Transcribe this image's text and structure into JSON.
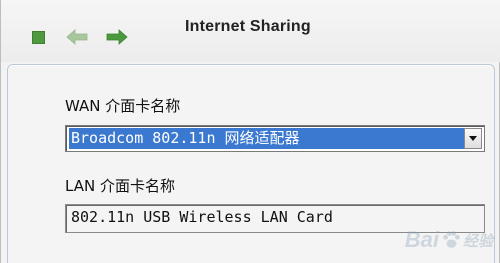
{
  "window": {
    "title": "Internet Sharing"
  },
  "toolbar": {
    "stop_icon": "stop-icon",
    "back_icon": "back-arrow-icon",
    "forward_icon": "forward-arrow-icon",
    "accent_color": "#4f9a3e"
  },
  "wan": {
    "label": "WAN 介面卡名称",
    "selected_value": "Broadcom 802.11n 网络适配器",
    "highlight_color": "#3b78d0"
  },
  "lan": {
    "label": "LAN 介面卡名称",
    "value": "802.11n USB Wireless LAN Card"
  },
  "watermark": {
    "text_left": "Bai",
    "text_right": "经验"
  }
}
